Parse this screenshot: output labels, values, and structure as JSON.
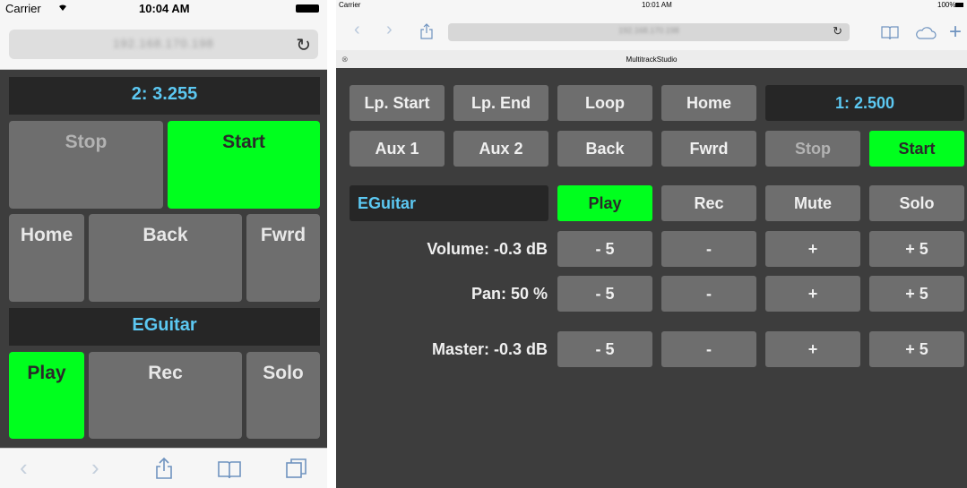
{
  "phone": {
    "status": {
      "carrier": "Carrier",
      "time": "10:04 AM"
    },
    "url": "192.168.170.198",
    "position_display": "2: 3.255",
    "transport": {
      "stop": "Stop",
      "start": "Start"
    },
    "nav": {
      "home": "Home",
      "back": "Back",
      "fwrd": "Fwrd"
    },
    "track_name": "EGuitar",
    "track": {
      "play": "Play",
      "rec": "Rec",
      "solo": "Solo"
    }
  },
  "ipad": {
    "status": {
      "carrier": "Carrier",
      "time": "10:01 AM",
      "battery": "100%"
    },
    "url": "192.168.170.198",
    "tab_title": "MultitrackStudio",
    "top_row": [
      "Lp. Start",
      "Lp. End",
      "Loop",
      "Home"
    ],
    "position_display": "1: 2.500",
    "second_row": [
      "Aux 1",
      "Aux 2",
      "Back",
      "Fwrd",
      "Stop",
      "Start"
    ],
    "track_name": "EGuitar",
    "track_row": [
      "Play",
      "Rec",
      "Mute",
      "Solo"
    ],
    "volume_label": "Volume: -0.3 dB",
    "pan_label": "Pan: 50 %",
    "master_label": "Master: -0.3 dB",
    "step_buttons": [
      "- 5",
      "-",
      "+",
      "+ 5"
    ]
  }
}
